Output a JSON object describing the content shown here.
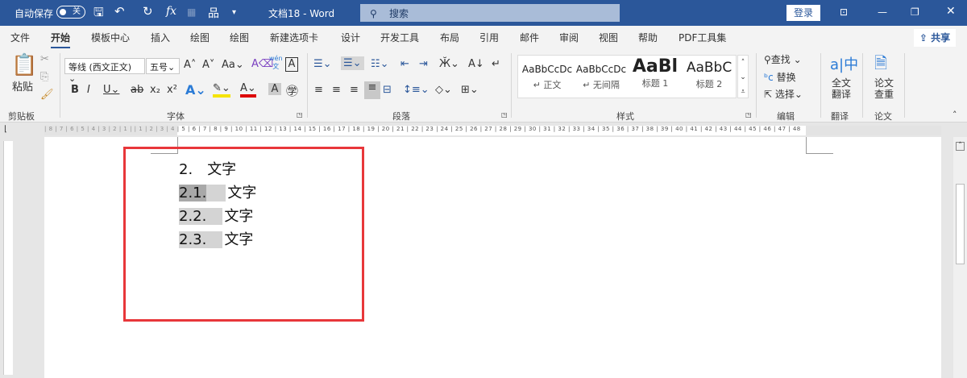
{
  "titlebar": {
    "autosave": "自动保存",
    "autosave_state": "关",
    "doc_title": "文档18  -  Word",
    "search_placeholder": "搜索",
    "login": "登录"
  },
  "menu": {
    "tabs": [
      "文件",
      "开始",
      "模板中心",
      "插入",
      "绘图",
      "绘图",
      "新建选项卡",
      "设计",
      "开发工具",
      "布局",
      "引用",
      "邮件",
      "审阅",
      "视图",
      "帮助",
      "PDF工具集"
    ],
    "active": "开始",
    "share": "共享"
  },
  "ribbon": {
    "clipboard": {
      "paste": "粘贴",
      "label": "剪贴板"
    },
    "font": {
      "name": "等线 (西文正文)",
      "size": "五号",
      "label": "字体",
      "change_case": "Aa",
      "phonetic": "wén"
    },
    "paragraph": {
      "label": "段落"
    },
    "styles": {
      "items": [
        {
          "preview": "AaBbCcDc",
          "name": "↵ 正文"
        },
        {
          "preview": "AaBbCcDc",
          "name": "↵ 无间隔"
        },
        {
          "preview": "AaBl",
          "name": "标题 1"
        },
        {
          "preview": "AaBbC",
          "name": "标题 2"
        }
      ],
      "label": "样式"
    },
    "editing": {
      "find": "查找",
      "replace": "替换",
      "select": "选择",
      "label": "编辑"
    },
    "translate": {
      "button": "全文翻译",
      "label": "翻译"
    },
    "paper": {
      "button": "论文查重",
      "label": "论文"
    }
  },
  "ruler": "| 8 | 7 | 6 | 5 | 4 | 3 | 2 | 1 |  | 1 | 2 | 3 | 4 | 5 | 6 | 7 | 8 | 9 | 10 | 11 | 12 | 13 | 14 | 15 | 16 | 17 | 18 | 19 | 20 | 21 | 22 | 23 | 24 | 25 | 26 | 27 | 28 | 29 | 30 | 31 | 32 | 33 | 34 | 35 | 36 | 37 | 38 | 39 | 40 | 41 | 42 | 43 | 44 | 45 | 46 | 47 | 48",
  "document": {
    "lines": [
      {
        "num": "2.",
        "text": "文字"
      },
      {
        "num": "2.1.",
        "text": "文字"
      },
      {
        "num": "2.2.",
        "text": "文字"
      },
      {
        "num": "2.3.",
        "text": "文字"
      }
    ]
  }
}
